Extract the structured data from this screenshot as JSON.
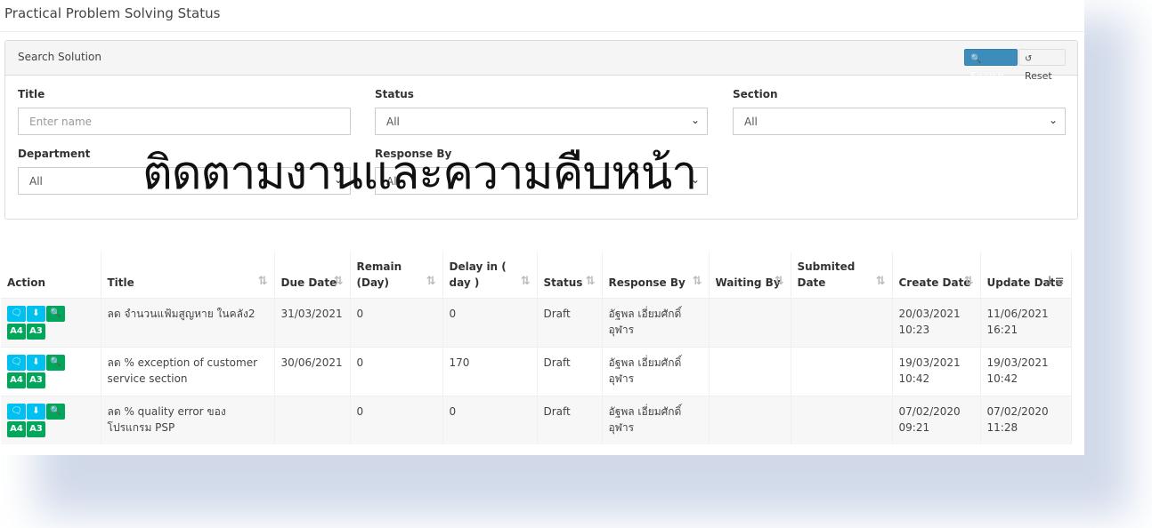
{
  "page": {
    "title": "Practical Problem Solving Status"
  },
  "search": {
    "header": "Search Solution",
    "search_label": "Search",
    "reset_label": "Reset",
    "fields": {
      "title_label": "Title",
      "title_placeholder": "Enter name",
      "status_label": "Status",
      "status_value": "All",
      "section_label": "Section",
      "section_value": "All",
      "department_label": "Department",
      "department_value": "All",
      "response_label": "Response By",
      "response_value": "All"
    }
  },
  "overlay_text": "ติดตามงานและความคืบหน้า",
  "table": {
    "headers": {
      "action": "Action",
      "title": "Title",
      "due_date": "Due Date",
      "remain": "Remain (Day)",
      "delay": "Delay in ( day )",
      "status": "Status",
      "response_by": "Response By",
      "waiting_by": "Waiting By",
      "submitted_date": "Submited Date",
      "create_date": "Create Date",
      "update_date": "Update Date"
    },
    "action_labels": {
      "a4": "A4",
      "a3": "A3"
    },
    "rows": [
      {
        "title": "ลด จำนวนแฟ้มสูญหาย ในคลัง2",
        "due_date": "31/03/2021",
        "remain": "0",
        "delay": "0",
        "status": "Draft",
        "response_by": "อัฐพล เอี่ยมศักดิ์ อุฬาร",
        "waiting_by": "",
        "submitted_date": "",
        "create_date": "20/03/2021 10:23",
        "update_date": "11/06/2021 16:21"
      },
      {
        "title": "ลด % exception of customer service section",
        "due_date": "30/06/2021",
        "remain": "0",
        "delay": "170",
        "status": "Draft",
        "response_by": "อัฐพล เอี่ยมศักดิ์ อุฬาร",
        "waiting_by": "",
        "submitted_date": "",
        "create_date": "19/03/2021 10:42",
        "update_date": "19/03/2021 10:42"
      },
      {
        "title": "ลด % quality error ของโปรแกรม PSP",
        "due_date": "",
        "remain": "0",
        "delay": "0",
        "status": "Draft",
        "response_by": "อัฐพล เอี่ยมศักดิ์ อุฬาร",
        "waiting_by": "",
        "submitted_date": "",
        "create_date": "07/02/2020 09:21",
        "update_date": "07/02/2020 11:28"
      }
    ]
  }
}
